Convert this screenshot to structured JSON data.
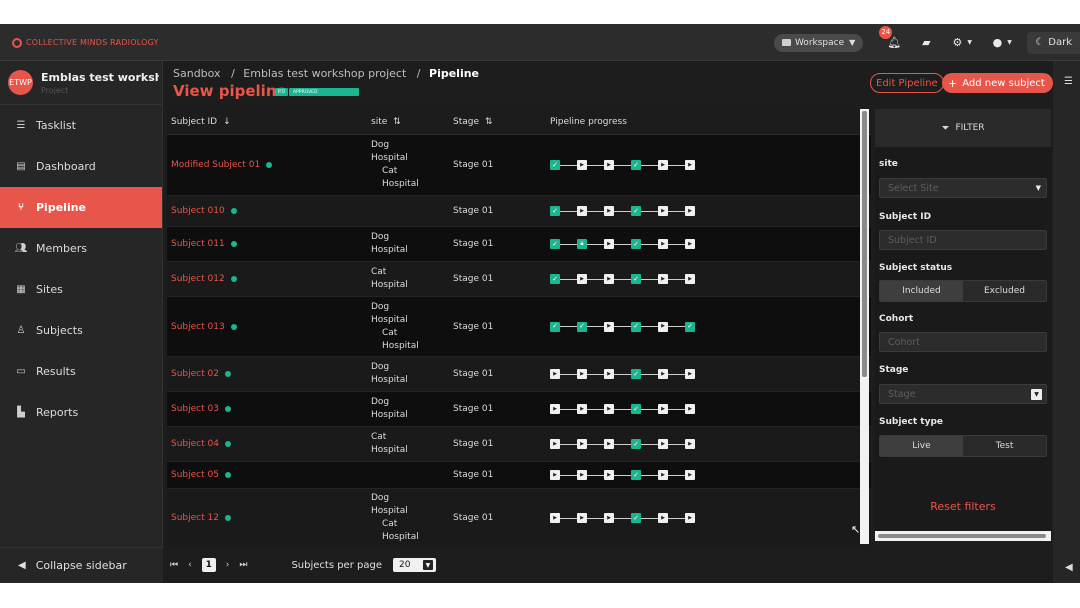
{
  "brand": {
    "name": "COLLECTIVE MINDS RADIOLOGY"
  },
  "topbar": {
    "workspace_label": "Workspace",
    "notifications_count": "24",
    "theme_label": "Dark"
  },
  "project": {
    "initials": "ETWP",
    "name": "Emblas test worksho...",
    "type": "Project"
  },
  "sidebar": {
    "items": [
      {
        "label": "Tasklist",
        "icon": "tasklist-icon"
      },
      {
        "label": "Dashboard",
        "icon": "dashboard-icon"
      },
      {
        "label": "Pipeline",
        "icon": "pipeline-icon",
        "active": true
      },
      {
        "label": "Members",
        "icon": "members-icon"
      },
      {
        "label": "Sites",
        "icon": "sites-icon"
      },
      {
        "label": "Subjects",
        "icon": "subjects-icon"
      },
      {
        "label": "Results",
        "icon": "results-icon"
      },
      {
        "label": "Reports",
        "icon": "reports-icon"
      }
    ],
    "collapse_label": "Collapse sidebar"
  },
  "breadcrumb": {
    "items": [
      "Sandbox",
      "Emblas test workshop project",
      "Pipeline"
    ]
  },
  "page": {
    "title": "View pipeline",
    "version_badge": "P.0",
    "status_badge": "APPROVED",
    "edit_label": "Edit Pipeline",
    "add_label": "Add new subject"
  },
  "table": {
    "columns": [
      "Subject ID",
      "site",
      "Stage",
      "Pipeline progress"
    ],
    "rows": [
      {
        "id": "Modified Subject 01",
        "site": [
          "Dog",
          "Hospital",
          "Cat",
          "Hospital"
        ],
        "stage": "Stage 01",
        "progress": [
          "done",
          "todo",
          "todo",
          "done",
          "todo",
          "todo"
        ]
      },
      {
        "id": "Subject 010",
        "site": [],
        "stage": "Stage 01",
        "progress": [
          "done",
          "todo",
          "todo",
          "done",
          "todo",
          "todo"
        ]
      },
      {
        "id": "Subject 011",
        "site": [
          "Dog",
          "Hospital"
        ],
        "stage": "Stage 01",
        "progress": [
          "done",
          "lock",
          "todo",
          "done",
          "todo",
          "todo"
        ]
      },
      {
        "id": "Subject 012",
        "site": [
          "Cat",
          "Hospital"
        ],
        "stage": "Stage 01",
        "progress": [
          "done",
          "todo",
          "todo",
          "done",
          "todo",
          "todo"
        ]
      },
      {
        "id": "Subject 013",
        "site": [
          "Dog",
          "Hospital",
          "Cat",
          "Hospital"
        ],
        "stage": "Stage 01",
        "progress": [
          "done",
          "done",
          "todo",
          "done",
          "todo",
          "done"
        ]
      },
      {
        "id": "Subject 02",
        "site": [
          "Dog",
          "Hospital"
        ],
        "stage": "Stage 01",
        "progress": [
          "todo",
          "todo",
          "todo",
          "done",
          "todo",
          "todo"
        ]
      },
      {
        "id": "Subject 03",
        "site": [
          "Dog",
          "Hospital"
        ],
        "stage": "Stage 01",
        "progress": [
          "todo",
          "todo",
          "todo",
          "done",
          "todo",
          "todo"
        ]
      },
      {
        "id": "Subject 04",
        "site": [
          "Cat",
          "Hospital"
        ],
        "stage": "Stage 01",
        "progress": [
          "todo",
          "todo",
          "todo",
          "done",
          "todo",
          "todo"
        ]
      },
      {
        "id": "Subject 05",
        "site": [],
        "stage": "Stage 01",
        "progress": [
          "todo",
          "todo",
          "todo",
          "done",
          "todo",
          "todo"
        ]
      },
      {
        "id": "Subject 12",
        "site": [
          "Dog",
          "Hospital",
          "Cat",
          "Hospital"
        ],
        "stage": "Stage 01",
        "progress": [
          "todo",
          "todo",
          "todo",
          "done",
          "todo",
          "todo"
        ]
      }
    ]
  },
  "filter": {
    "title": "FILTER",
    "site_label": "site",
    "site_placeholder": "Select Site",
    "subject_id_label": "Subject ID",
    "subject_id_placeholder": "Subject ID",
    "status_label": "Subject status",
    "status_options": [
      "Included",
      "Excluded"
    ],
    "cohort_label": "Cohort",
    "cohort_placeholder": "Cohort",
    "stage_label": "Stage",
    "stage_placeholder": "Stage",
    "type_label": "Subject type",
    "type_options": [
      "Live",
      "Test"
    ],
    "reset_label": "Reset filters"
  },
  "pager": {
    "current_page": "1",
    "per_page_label": "Subjects per page",
    "per_page_value": "20"
  },
  "colors": {
    "accent": "#e8554a",
    "success": "#1bb591",
    "background": "#1d1d1d"
  }
}
